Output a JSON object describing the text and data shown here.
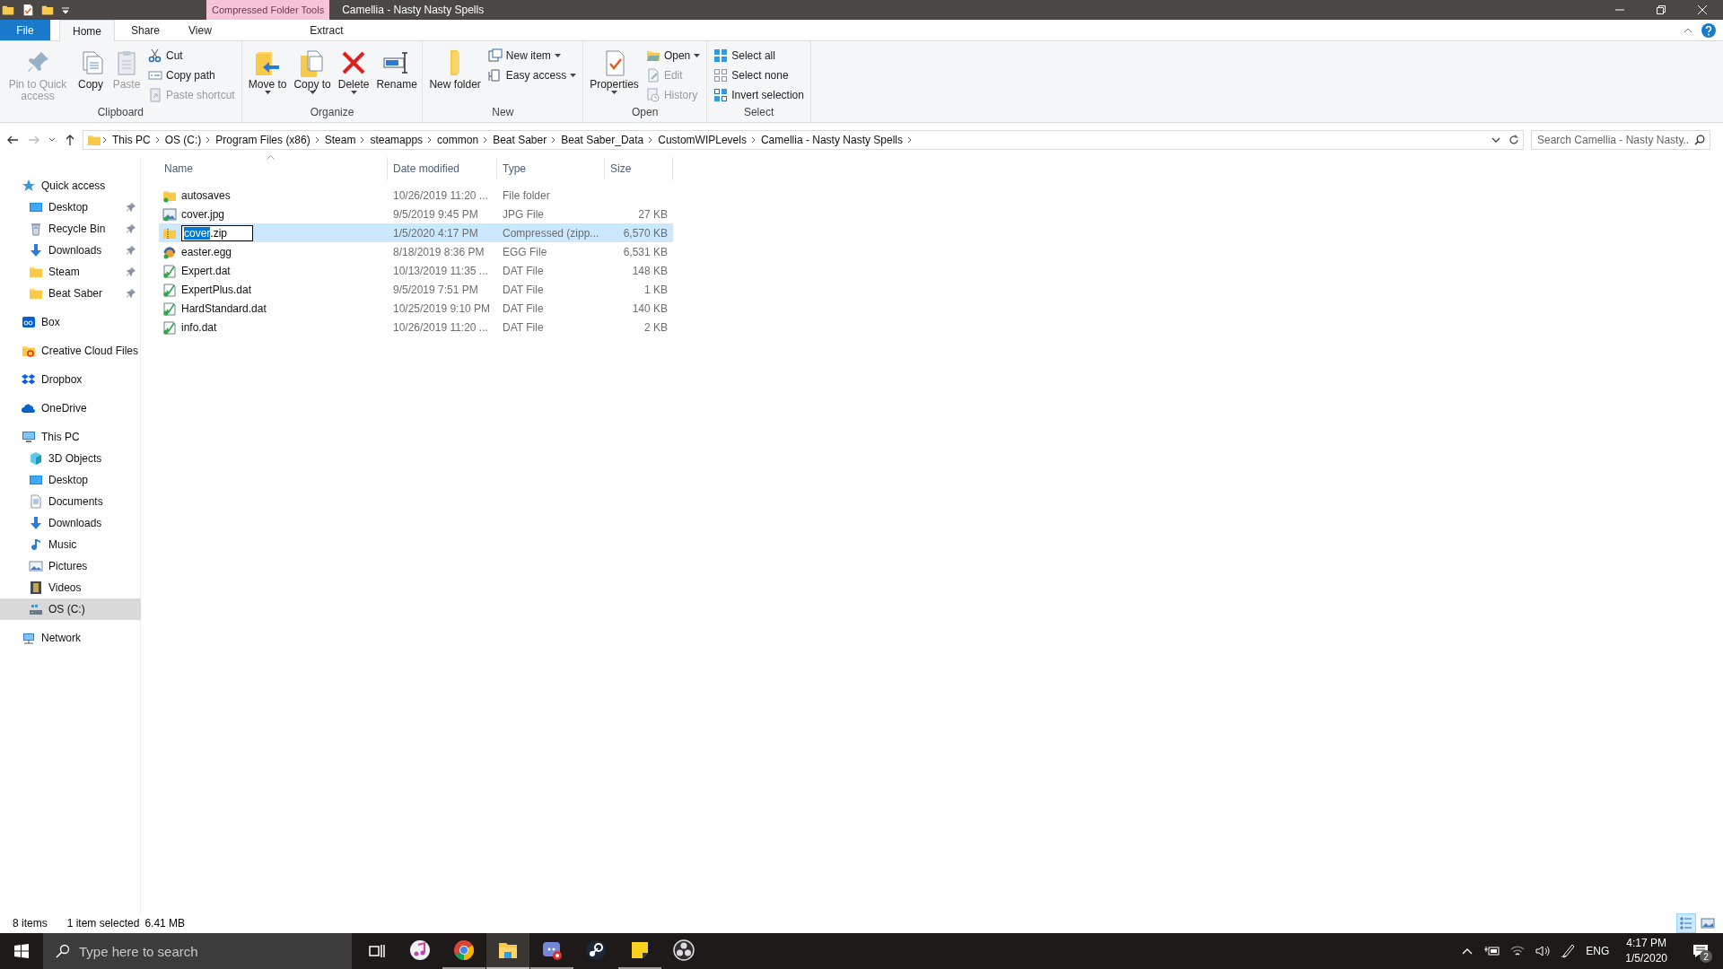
{
  "title_bar": {
    "context_tab": "Compressed Folder Tools",
    "title": "Camellia - Nasty Nasty Spells"
  },
  "ribbon_tabs": [
    {
      "label": "File",
      "kind": "file",
      "selected": false
    },
    {
      "label": "Home",
      "kind": "tab",
      "selected": true
    },
    {
      "label": "Share",
      "kind": "tab",
      "selected": false
    },
    {
      "label": "View",
      "kind": "tab",
      "selected": false
    },
    {
      "label": "Extract",
      "kind": "context",
      "selected": false
    }
  ],
  "ribbon_groups": [
    {
      "label": "Clipboard",
      "large_commands": [
        {
          "label": "Pin to Quick access",
          "kind": "pin",
          "disabled": true,
          "dropdown": false
        },
        {
          "label": "Copy",
          "kind": "copy",
          "disabled": false,
          "dropdown": false
        },
        {
          "label": "Paste",
          "kind": "paste",
          "disabled": true,
          "dropdown": false
        }
      ],
      "small_commands": [
        {
          "label": "Cut",
          "kind": "cut",
          "disabled": false,
          "dropdown": false
        },
        {
          "label": "Copy path",
          "kind": "copypath",
          "disabled": false,
          "dropdown": false
        },
        {
          "label": "Paste shortcut",
          "kind": "shortcut",
          "disabled": true,
          "dropdown": false
        }
      ]
    },
    {
      "label": "Organize",
      "large_commands": [
        {
          "label": "Move to",
          "kind": "move",
          "disabled": false,
          "dropdown": true
        },
        {
          "label": "Copy to",
          "kind": "copyto",
          "disabled": false,
          "dropdown": true
        },
        {
          "label": "Delete",
          "kind": "delete",
          "disabled": false,
          "dropdown": true
        },
        {
          "label": "Rename",
          "kind": "rename",
          "disabled": false,
          "dropdown": false
        }
      ]
    },
    {
      "label": "New",
      "large_commands": [
        {
          "label": "New folder",
          "kind": "newfolder",
          "disabled": false,
          "dropdown": false
        }
      ],
      "small_commands": [
        {
          "label": "New item",
          "kind": "newitem",
          "disabled": false,
          "dropdown": true
        },
        {
          "label": "Easy access",
          "kind": "easy",
          "disabled": false,
          "dropdown": true
        }
      ]
    },
    {
      "label": "Open",
      "large_commands": [
        {
          "label": "Properties",
          "kind": "properties",
          "disabled": false,
          "dropdown": true
        }
      ],
      "small_commands": [
        {
          "label": "Open",
          "kind": "open",
          "disabled": false,
          "dropdown": true
        },
        {
          "label": "Edit",
          "kind": "edit",
          "disabled": true,
          "dropdown": false
        },
        {
          "label": "History",
          "kind": "history",
          "disabled": true,
          "dropdown": false
        }
      ]
    },
    {
      "label": "Select",
      "small_commands": [
        {
          "label": "Select all",
          "kind": "selectall",
          "disabled": false,
          "dropdown": false
        },
        {
          "label": "Select none",
          "kind": "selectnone",
          "disabled": false,
          "dropdown": false
        },
        {
          "label": "Invert selection",
          "kind": "invert",
          "disabled": false,
          "dropdown": false
        }
      ]
    }
  ],
  "address_bar": {
    "crumbs": [
      "This PC",
      "OS (C:)",
      "Program Files (x86)",
      "Steam",
      "steamapps",
      "common",
      "Beat Saber",
      "Beat Saber_Data",
      "CustomWIPLevels",
      "Camellia - Nasty Nasty Spells"
    ],
    "search": {
      "placeholder": "Search Camellia - Nasty Nasty..."
    }
  },
  "sidebar": {
    "items": [
      {
        "label": "Quick access",
        "kind": "star",
        "selected": false,
        "children": [
          {
            "label": "Desktop",
            "kind": "desktop",
            "pinned": true,
            "selected": false
          },
          {
            "label": "Recycle Bin",
            "kind": "recycle",
            "pinned": true,
            "selected": false
          },
          {
            "label": "Downloads",
            "kind": "download",
            "pinned": true,
            "selected": false
          },
          {
            "label": "Steam",
            "kind": "folder",
            "pinned": true,
            "selected": false
          },
          {
            "label": "Beat Saber",
            "kind": "folder",
            "pinned": true,
            "selected": false
          }
        ]
      },
      {
        "label": "Box",
        "kind": "box",
        "selected": false
      },
      {
        "label": "Creative Cloud Files",
        "kind": "ccfiles",
        "selected": false
      },
      {
        "label": "Dropbox",
        "kind": "dropbox",
        "selected": false
      },
      {
        "label": "OneDrive",
        "kind": "onedrive",
        "selected": false
      },
      {
        "label": "This PC",
        "kind": "pc",
        "selected": false,
        "children": [
          {
            "label": "3D Objects",
            "kind": "cube",
            "pinned": false,
            "selected": false
          },
          {
            "label": "Desktop",
            "kind": "desktop",
            "pinned": false,
            "selected": false
          },
          {
            "label": "Documents",
            "kind": "documents",
            "pinned": false,
            "selected": false
          },
          {
            "label": "Downloads",
            "kind": "download",
            "pinned": false,
            "selected": false
          },
          {
            "label": "Music",
            "kind": "music",
            "pinned": false,
            "selected": false
          },
          {
            "label": "Pictures",
            "kind": "pictures",
            "pinned": false,
            "selected": false
          },
          {
            "label": "Videos",
            "kind": "videos",
            "pinned": false,
            "selected": false
          },
          {
            "label": "OS (C:)",
            "kind": "drive",
            "pinned": false,
            "selected": true
          }
        ]
      },
      {
        "label": "Network",
        "kind": "network",
        "selected": false
      }
    ]
  },
  "table": {
    "columns": [
      "Name",
      "Date modified",
      "Type",
      "Size"
    ],
    "rows": [
      {
        "kind": "folder",
        "name": "autosaves",
        "date": "10/26/2019 11:20 ...",
        "type": "File folder",
        "size": "",
        "selected": false
      },
      {
        "kind": "image",
        "name": "cover.jpg",
        "date": "9/5/2019 9:45 PM",
        "type": "JPG File",
        "size": "27 KB",
        "selected": false
      },
      {
        "kind": "zip",
        "rename_field": {
          "selected_text": "cover",
          "rest_text": ".zip"
        },
        "date": "1/5/2020 4:17 PM",
        "type": "Compressed (zipp...",
        "size": "6,570 KB",
        "selected": true
      },
      {
        "kind": "egg",
        "name": "easter.egg",
        "date": "8/18/2019 8:36 PM",
        "type": "EGG File",
        "size": "6,531 KB",
        "selected": false
      },
      {
        "kind": "dat",
        "name": "Expert.dat",
        "date": "10/13/2019 11:35 ...",
        "type": "DAT File",
        "size": "148 KB",
        "selected": false
      },
      {
        "kind": "dat",
        "name": "ExpertPlus.dat",
        "date": "9/5/2019 7:51 PM",
        "type": "DAT File",
        "size": "1 KB",
        "selected": false
      },
      {
        "kind": "dat",
        "name": "HardStandard.dat",
        "date": "10/25/2019 9:10 PM",
        "type": "DAT File",
        "size": "140 KB",
        "selected": false
      },
      {
        "kind": "dat",
        "name": "info.dat",
        "date": "10/26/2019 11:20 ...",
        "type": "DAT File",
        "size": "2 KB",
        "selected": false
      }
    ]
  },
  "status_bar": {
    "item_count": "8 items",
    "selection": "1 item selected",
    "selection_size": "6.41 MB",
    "views": [
      {
        "kind": "details",
        "selected": true
      },
      {
        "kind": "large-icons",
        "selected": false
      }
    ]
  },
  "taskbar": {
    "search": {
      "placeholder": "Type here to search"
    },
    "apps": [
      {
        "kind": "music",
        "running": false,
        "active": false
      },
      {
        "kind": "browser",
        "running": true,
        "active": false
      },
      {
        "kind": "explorer",
        "running": true,
        "active": true
      },
      {
        "kind": "chat",
        "running": true,
        "active": false
      },
      {
        "kind": "steam",
        "running": false,
        "active": false
      },
      {
        "kind": "notes",
        "running": true,
        "active": false
      },
      {
        "kind": "recorder",
        "running": false,
        "active": false
      }
    ],
    "language": "ENG",
    "time": "4:17 PM",
    "date": "1/5/2020",
    "notification_count": "2"
  }
}
